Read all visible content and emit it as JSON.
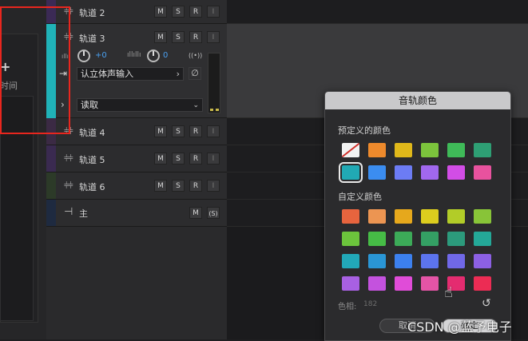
{
  "left": {
    "time_label": "时间",
    "plus_icon": "+"
  },
  "tracks": [
    {
      "name": "轨道 2",
      "buttons": [
        "M",
        "S",
        "R",
        "I"
      ],
      "color": "#3b2a55"
    },
    {
      "name": "轨道 3",
      "buttons": [
        "M",
        "S",
        "R",
        "I"
      ],
      "color": "#20b2b8",
      "volume": "+0",
      "pan": "0",
      "input": "认立体声输入",
      "automation": "读取"
    },
    {
      "name": "轨道 4",
      "buttons": [
        "M",
        "S",
        "R",
        "I"
      ],
      "color": "#3b2a44"
    },
    {
      "name": "轨道 5",
      "buttons": [
        "M",
        "S",
        "R",
        "I"
      ],
      "color": "#3a2a50"
    },
    {
      "name": "轨道 6",
      "buttons": [
        "M",
        "S",
        "R",
        "I"
      ],
      "color": "#2c3a28"
    },
    {
      "name": "主",
      "buttons": [
        "M",
        "(S)"
      ],
      "color": "#1e2a40"
    }
  ],
  "dialog": {
    "title": "音轨颜色",
    "predefined_label": "预定义的颜色",
    "custom_label": "自定义颜色",
    "hue_label": "色相:",
    "hue_value": "182",
    "cancel": "取消",
    "ok": "确定",
    "predefined_colors": [
      "none",
      "#ee8a2c",
      "#e0b81a",
      "#7cc43c",
      "#3fba58",
      "#2e9f74",
      "#21a9b4",
      "#3b8df0",
      "#6c7cf4",
      "#a168ee",
      "#d24de6",
      "#e8529e"
    ],
    "selected_index": 6,
    "custom_colors": [
      "#e7643e",
      "#ec9552",
      "#e6a81c",
      "#dccd1e",
      "#b2cc28",
      "#88c438",
      "#6cc43c",
      "#46bc46",
      "#3caa58",
      "#34a064",
      "#2c9a7c",
      "#24a898",
      "#22a8b8",
      "#2a96d6",
      "#3c80ee",
      "#5c74ee",
      "#7068e8",
      "#8c60e4",
      "#a860e2",
      "#c452de",
      "#e04cd8",
      "#e454a6",
      "#e42c70",
      "#ec2c54"
    ]
  },
  "watermark": "CSDN @蓝予电子"
}
